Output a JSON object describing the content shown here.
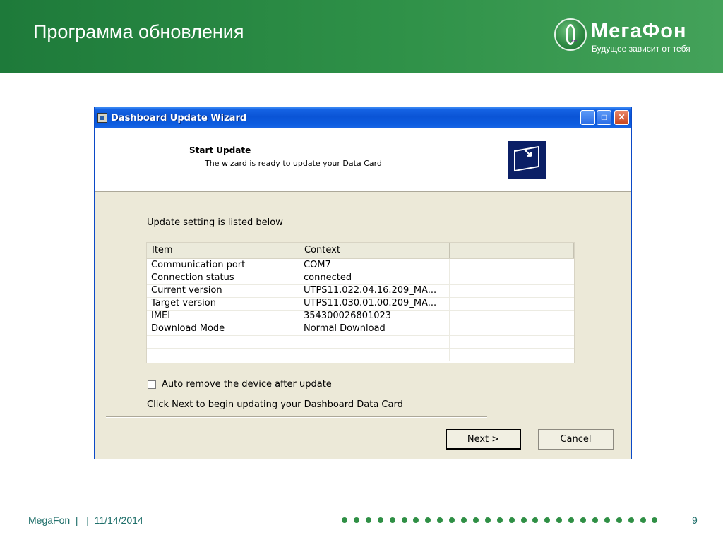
{
  "header": {
    "title": "Программа обновления",
    "logo_name": "МегаФон",
    "logo_tagline": "Будущее зависит от тебя",
    "colors": {
      "band": "#2f9148",
      "text": "#ffffff"
    }
  },
  "window": {
    "title": "Dashboard Update Wizard",
    "buttons": {
      "minimize": "_",
      "maximize": "□",
      "close": "✕"
    },
    "banner": {
      "title": "Start Update",
      "subtitle": "The wizard is ready to update your Data Card",
      "icon": "update-wizard-icon"
    },
    "section_label": "Update setting is listed below",
    "table": {
      "columns": [
        "Item",
        "Context",
        ""
      ],
      "rows": [
        {
          "item": "Communication port",
          "context": "COM7"
        },
        {
          "item": "Connection status",
          "context": "connected"
        },
        {
          "item": "Current version",
          "context": "UTPS11.022.04.16.209_MA..."
        },
        {
          "item": "Target version",
          "context": "UTPS11.030.01.00.209_MA..."
        },
        {
          "item": "IMEI",
          "context": "354300026801023"
        },
        {
          "item": "Download Mode",
          "context": "Normal Download"
        },
        {
          "item": "",
          "context": ""
        },
        {
          "item": "",
          "context": ""
        }
      ]
    },
    "checkbox": {
      "label": "Auto remove the device after update",
      "checked": false
    },
    "instruction": "Click Next to begin updating your Dashboard Data Card",
    "next_button": "Next >",
    "cancel_button": "Cancel"
  },
  "footer": {
    "text": "MegaFon  |   |  11/14/2014",
    "page_number": "9",
    "dot_color": "#2f8f45"
  }
}
